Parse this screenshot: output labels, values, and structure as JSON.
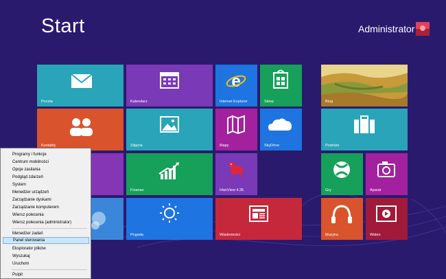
{
  "start": {
    "title": "Start"
  },
  "user": {
    "name": "Administrator"
  },
  "colors": {
    "background": "#2a1a6e",
    "cyan": "#2aa4b8",
    "purple": "#7a39b6",
    "blue": "#1e74e0",
    "green": "#16a05a",
    "orange": "#d9532c",
    "magenta": "#a3219e",
    "red": "#c4283a",
    "darkred": "#a11a3a"
  },
  "tiles": {
    "poczta": "Poczta",
    "kalendarz": "Kalendarz",
    "ie": "Internet Explorer",
    "sklep": "Sklep",
    "bing": "Bing",
    "kontakty": "Kontakty",
    "zdjecia": "Zdjęcia",
    "mapy": "Mapy",
    "skydrive": "SkyDrive",
    "podroze": "Podróże",
    "finanse": "Finanse",
    "irfanview": "IrfanView 4.35",
    "gry": "Gry",
    "aparat": "Aparat",
    "pogoda": "Pogoda",
    "wiadomosci": "Wiadomości",
    "muzyka": "Muzyka",
    "wideo": "Wideo"
  },
  "menu": {
    "items": [
      "Programy i funkcje",
      "Centrum mobilności",
      "Opcje zasilania",
      "Podgląd zdarzeń",
      "System",
      "Menedżer urządzeń",
      "Zarządzanie dyskami",
      "Zarządzanie komputerem",
      "Wiersz polecenia",
      "Wiersz polecenia (administrator)",
      "Menedżer zadań",
      "Panel sterowania",
      "Eksplorator plików",
      "Wyszukaj",
      "Uruchom",
      "Pulpit"
    ]
  }
}
